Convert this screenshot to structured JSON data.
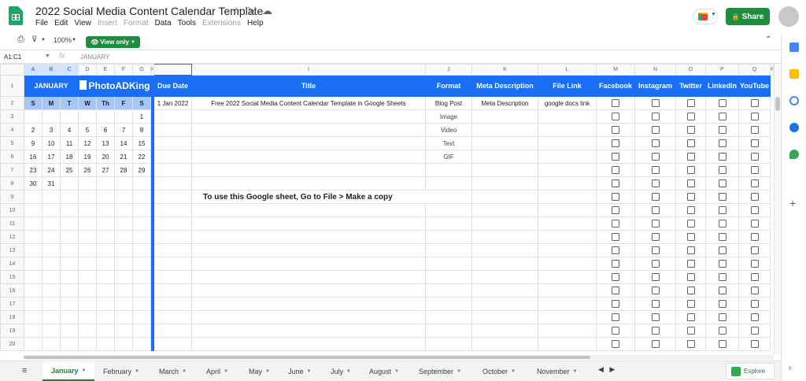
{
  "title_bar": {
    "doc_title": "2022 Social Media Content Calendar Template",
    "share_label": "Share",
    "icons": [
      "star-icon",
      "move-icon",
      "cloud-icon"
    ]
  },
  "menu": [
    "File",
    "Edit",
    "View",
    "Insert",
    "Format",
    "Data",
    "Tools",
    "Extensions",
    "Help"
  ],
  "menu_disabled": [
    "Insert",
    "Format",
    "Extensions"
  ],
  "toolbar": {
    "zoom": "100%",
    "view_mode": "View only"
  },
  "formula_bar": {
    "cell_ref": "A1:C1",
    "fx": "fx",
    "content": "JANUARY"
  },
  "column_headers": [
    "A",
    "B",
    "C",
    "D",
    "E",
    "F",
    "G",
    "H",
    "I",
    "J",
    "K",
    "L",
    "M",
    "N",
    "O",
    "P",
    "Q",
    "R"
  ],
  "selected_columns": [
    "A",
    "B",
    "C"
  ],
  "header_row": {
    "january": "JANUARY",
    "brand": "PhotoADKing",
    "due_date": "Due Date",
    "title": "Title",
    "format": "Format",
    "meta_description": "Meta Description",
    "file_link": "File Link",
    "facebook": "Facebook",
    "instagram": "Instagram",
    "twitter": "Twitter",
    "linkedin": "LinkedIn",
    "youtube": "YouTube"
  },
  "days_of_week": [
    "S",
    "M",
    "T",
    "W",
    "Th",
    "F",
    "S"
  ],
  "calendar_weeks": [
    [
      "",
      "",
      "",
      "",
      "",
      "",
      "1"
    ],
    [
      "2",
      "3",
      "4",
      "5",
      "6",
      "7",
      "8"
    ],
    [
      "9",
      "10",
      "11",
      "12",
      "13",
      "14",
      "15"
    ],
    [
      "16",
      "17",
      "18",
      "19",
      "20",
      "21",
      "22"
    ],
    [
      "23",
      "24",
      "25",
      "26",
      "27",
      "28",
      "29"
    ],
    [
      "30",
      "31",
      "",
      "",
      "",
      "",
      ""
    ]
  ],
  "content_row": {
    "due_date": "1 Jan 2022",
    "title": "Free 2022 Social Media Content Calendar Template in Google Sheets",
    "format": "Blog Post",
    "meta_description": "Meta Description",
    "file_link": "google docs link"
  },
  "format_options": [
    "Image",
    "Video",
    "Text",
    "GIF"
  ],
  "note": "To use this Google sheet, Go to File > Make a copy",
  "row_numbers": [
    "1",
    "2",
    "3",
    "4",
    "5",
    "6",
    "7",
    "8",
    "9",
    "10",
    "11",
    "12",
    "13",
    "14",
    "15",
    "16",
    "17",
    "18",
    "19",
    "20"
  ],
  "sheet_tabs": [
    "January",
    "February",
    "March",
    "April",
    "May",
    "June",
    "July",
    "August",
    "September",
    "October",
    "November"
  ],
  "active_tab": "January",
  "explore_label": "Explore",
  "colors": {
    "header_blue": "#1a6ef5",
    "dow_blue": "#a6c6f7",
    "share_green": "#1e8e3e",
    "tab_active_green": "#188038"
  }
}
